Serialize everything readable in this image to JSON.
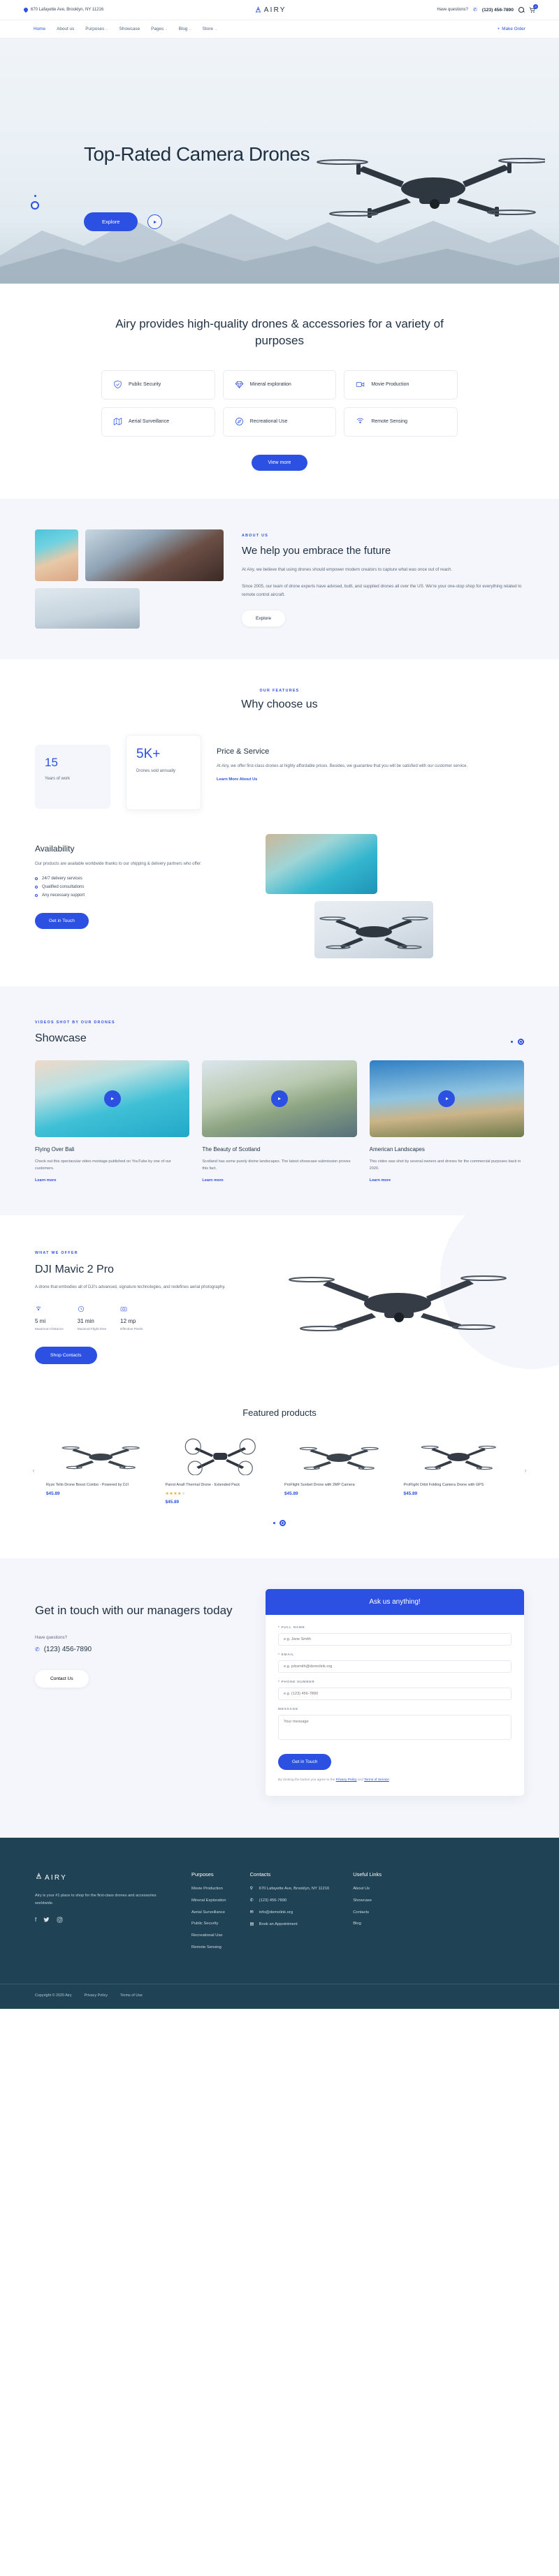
{
  "topbar": {
    "address": "670 Lafayette Ave, Brooklyn, NY 11216",
    "logo_text": "AIRY",
    "have_questions": "Have questions?",
    "phone": "(123) 456-7890",
    "cart_count": "3"
  },
  "nav": {
    "items": [
      {
        "label": "Home",
        "caret": "",
        "active": true
      },
      {
        "label": "About us",
        "caret": "",
        "active": false
      },
      {
        "label": "Purposes",
        "caret": "⌄",
        "active": false
      },
      {
        "label": "Showcase",
        "caret": "",
        "active": false
      },
      {
        "label": "Pages",
        "caret": "⌄",
        "active": false
      },
      {
        "label": "Blog",
        "caret": "⌄",
        "active": false
      },
      {
        "label": "Store",
        "caret": "⌄",
        "active": false
      }
    ],
    "make_order": "Make Order",
    "make_order_icon": "+"
  },
  "hero": {
    "title": "Top-Rated Camera Drones",
    "explore_label": "Explore",
    "play_icon": "play-icon"
  },
  "purposes": {
    "heading": "Airy provides high-quality drones & accessories for a variety of purposes",
    "chips": [
      {
        "label": "Public Security",
        "icon": "shield-check-icon"
      },
      {
        "label": "Mineral exploration",
        "icon": "gem-icon"
      },
      {
        "label": "Movie Production",
        "icon": "video-camera-icon"
      },
      {
        "label": "Aerial Surveillance",
        "icon": "map-icon"
      },
      {
        "label": "Recreational Use",
        "icon": "compass-icon"
      },
      {
        "label": "Remote Sensing",
        "icon": "signal-icon"
      }
    ],
    "view_more": "View more"
  },
  "about": {
    "eyebrow": "ABOUT US",
    "heading": "We help you embrace the future",
    "paragraph1": "At Airy, we believe that using drones should empower modern creators to capture what was once out of reach.",
    "paragraph2": "Since 2005, our team of drone experts have advised, built, and supplied drones all over the US. We're your one-stop shop for everything related to remote control aircraft.",
    "button": "Explore"
  },
  "features": {
    "eyebrow": "OUR FEATURES",
    "heading": "Why choose us",
    "stats": [
      {
        "value": "15",
        "label": "Years of work"
      },
      {
        "value": "5K+",
        "label": "Drones sold annually"
      }
    ],
    "price": {
      "title": "Price & Service",
      "text": "At Airy, we offer first-class drones at highly affordable prices. Besides, we guarantee that you will be satisfied with our customer service.",
      "link": "Learn More About Us"
    },
    "availability": {
      "title": "Availability",
      "text": "Our products are available worldwide thanks to our shipping & delivery partners who offer:",
      "items": [
        "24/7 delivery services",
        "Qualified consultations",
        "Any necessary support"
      ],
      "button": "Get in Touch"
    }
  },
  "showcase": {
    "eyebrow": "VIDEOS SHOT BY OUR DRONES",
    "heading": "Showcase",
    "cards": [
      {
        "title": "Flying Over Bali",
        "desc": "Check out this spectacular video montage published on YouTube by one of our customers.",
        "link": "Learn more"
      },
      {
        "title": "The Beauty of Scotland",
        "desc": "Scotland has some purely divine landscapes. The latest showcase submission proves this fact.",
        "link": "Learn more"
      },
      {
        "title": "American Landscapes",
        "desc": "This video was shot by several owners and drones for the commercial purposes back in 2020.",
        "link": "Learn more"
      }
    ]
  },
  "dji": {
    "eyebrow": "WHAT WE OFFER",
    "title": "DJI Mavic 2 Pro",
    "desc": "A drone that embodies all of DJI's advanced, signature technologies, and redefines aerial photography.",
    "specs": [
      {
        "icon": "signal-icon",
        "value": "5 mi",
        "label": "Maximum Distance"
      },
      {
        "icon": "clock-icon",
        "value": "31 min",
        "label": "Maximal Flight time"
      },
      {
        "icon": "camera-icon",
        "value": "12 mp",
        "label": "Effective Pixels"
      }
    ],
    "button": "Shop Contacts"
  },
  "products": {
    "heading": "Featured products",
    "items": [
      {
        "name": "Ryze Tello Drone Boost Combo - Powered by DJI",
        "rating": 0,
        "price": "$45.89"
      },
      {
        "name": "Parrot Anafi Thermal Drone - Extended Pack",
        "rating": 4,
        "price": "$45.89"
      },
      {
        "name": "ProFlight Sunbet Drone with 2MP Camera",
        "rating": 0,
        "price": "$45.89"
      },
      {
        "name": "ProFlight Orbit Folding Camera Drone with GPS",
        "rating": 0,
        "price": "$45.89"
      }
    ]
  },
  "contact": {
    "heading": "Get in touch with our managers today",
    "have_questions": "Have questions?",
    "phone": "(123) 456-7890",
    "button": "Contact Us",
    "form": {
      "title": "Ask us anything!",
      "fields": [
        {
          "label": "* FULL NAME",
          "placeholder": "e.g. Jane Smith",
          "value": ""
        },
        {
          "label": "* EMAIL",
          "placeholder": "e.g. jobsmith@demolink.org",
          "value": ""
        },
        {
          "label": "* PHONE NUMBER",
          "placeholder": "e.g. (123) 456-7890",
          "value": ""
        }
      ],
      "message_label": "MESSAGE",
      "message_placeholder": "Your message",
      "send_label": "Get in Touch",
      "agree_pre": "By clicking the button you agree to the ",
      "privacy": "Privacy Policy",
      "agree_mid": " and ",
      "terms": "Terms of Service",
      "agree_post": "."
    }
  },
  "footer": {
    "logo_text": "AIRY",
    "desc": "Airy is your #1 place to shop for the first-class drones and accessories worldwide.",
    "social": [
      "facebook-icon",
      "twitter-icon",
      "instagram-icon"
    ],
    "columns": [
      {
        "title": "Purposes",
        "links": [
          "Movie Production",
          "Mineral Exploration",
          "Aerial Surveillance",
          "Public Security",
          "Recreational Use",
          "Remote Sensing"
        ]
      },
      {
        "title": "Useful Links",
        "links": [
          "About Us",
          "Showcase",
          "Contacts",
          "Blog"
        ]
      }
    ],
    "contacts": {
      "title": "Contacts",
      "items": [
        {
          "icon": "pin-icon",
          "text": "670 Lafayette Ave, Brooklyn, NY 11216"
        },
        {
          "icon": "phone-icon",
          "text": "(123) 456-7890"
        },
        {
          "icon": "mail-icon",
          "text": "info@demolink.org"
        },
        {
          "icon": "book-icon",
          "text": "Book an Appointment"
        }
      ]
    },
    "bottom": [
      "Copyright © 2020 Airy",
      "Privacy Policy",
      "Terms of Use"
    ]
  },
  "colors": {
    "accent": "#2b50e2",
    "dark": "#1f4255",
    "text": "#1f3042"
  }
}
